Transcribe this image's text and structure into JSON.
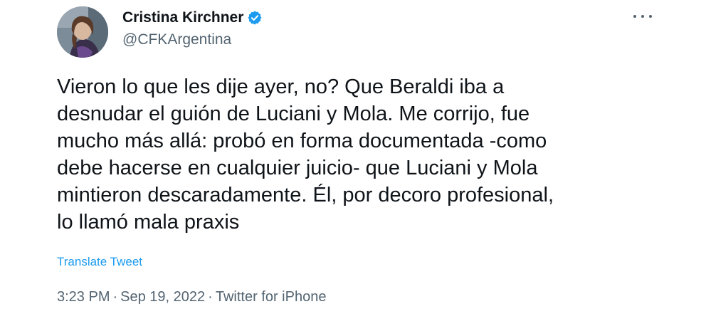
{
  "author": {
    "display_name": "Cristina Kirchner",
    "handle": "@CFKArgentina",
    "verified_icon": "verified-badge-icon",
    "avatar_icon": "profile-photo"
  },
  "more_icon": "more-options-icon",
  "tweet": {
    "text": "Vieron lo que les dije ayer, no? Que Beraldi iba a\ndesnudar el guión de Luciani y Mola. Me corrijo, fue\nmucho más allá: probó en forma documentada -como\ndebe hacerse en cualquier juicio- que Luciani y Mola\nmintieron descaradamente. Él, por decoro profesional,\nlo llamó mala praxis",
    "translate_label": "Translate Tweet"
  },
  "meta": {
    "time": "3:23 PM",
    "separator": "·",
    "date": "Sep 19, 2022",
    "source": "Twitter for iPhone"
  },
  "colors": {
    "text": "#0f1419",
    "secondary": "#536471",
    "link": "#1d9bf0",
    "verified": "#1d9bf0"
  }
}
